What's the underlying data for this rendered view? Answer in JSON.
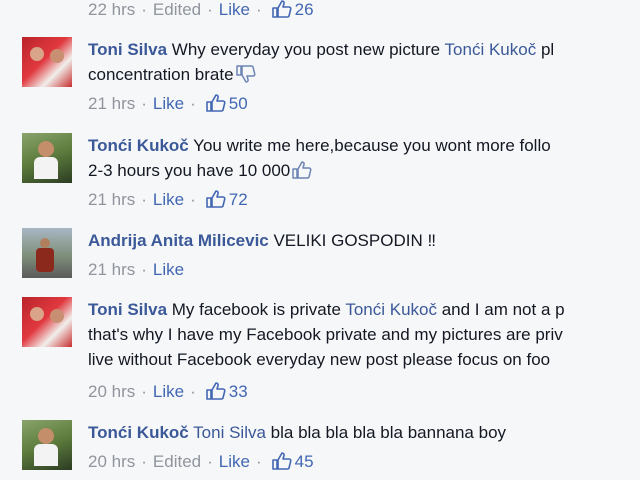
{
  "top_meta": {
    "time": "22 hrs",
    "edited": "Edited",
    "like": "Like",
    "count": "26"
  },
  "comments": [
    {
      "author": "Toni Silva",
      "line1_text": " Why everyday you post new picture ",
      "line1_mention": "Tonći Kukoč",
      "line1_tail": " pl",
      "line2_text": "concentration brate",
      "emoticon": "thumbs-down-emoticon",
      "time": "21 hrs",
      "like": "Like",
      "count": "50"
    },
    {
      "author": "Tonći Kukoč",
      "line1_text": " You write me here,because you wont more follo",
      "line2_text": "2-3 hours you have 10 000",
      "emoticon": "thumbs-up-emoticon",
      "time": "21 hrs",
      "like": "Like",
      "count": "72"
    },
    {
      "author": "Andrija Anita Milicevic",
      "line1_text": " VELIKI GOSPODIN ‼",
      "time": "21 hrs",
      "like": "Like"
    },
    {
      "author": "Toni Silva",
      "line1_text": " My facebook is private ",
      "line1_mention": "Tonći Kukoč",
      "line1_tail": " and I am not a p",
      "line2_text": "that's why I have my Facebook private and my pictures are priv",
      "line3_text": "live without Facebook everyday new post please focus on foo",
      "time": "20 hrs",
      "like": "Like",
      "count": "33"
    },
    {
      "author": "Tonći Kukoč",
      "line1_mention": "Toni Silva",
      "line1_tail": " bla bla bla bla bla bannana boy",
      "time": "20 hrs",
      "edited": "Edited",
      "like": "Like",
      "count": "45"
    }
  ],
  "colors": {
    "link": "#3b5998",
    "meta": "#90949c",
    "like": "#4267b2",
    "background": "#f6f7f9"
  },
  "icons": {
    "like_count": "thumbs-up-icon"
  }
}
